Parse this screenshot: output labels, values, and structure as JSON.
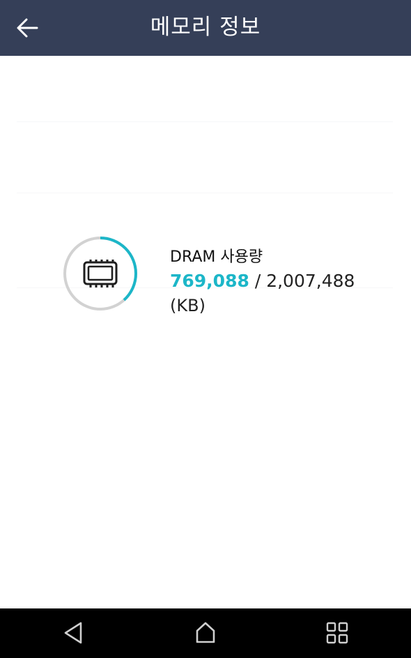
{
  "app_bar": {
    "title": "메모리 정보",
    "back_icon": "arrow-left-icon",
    "background": "#353f58"
  },
  "memory": {
    "label": "DRAM 사용량",
    "used": "769,088",
    "separator": " / ",
    "total": "2,007,488",
    "unit": "(KB)",
    "used_fraction": 0.383,
    "accent_color": "#1cb6c8",
    "track_color": "#d2d2d2",
    "icon": "memory-chip-icon"
  },
  "nav_bar": {
    "back_icon": "triangle-back-icon",
    "home_icon": "home-icon",
    "recents_icon": "grid-recents-icon"
  }
}
